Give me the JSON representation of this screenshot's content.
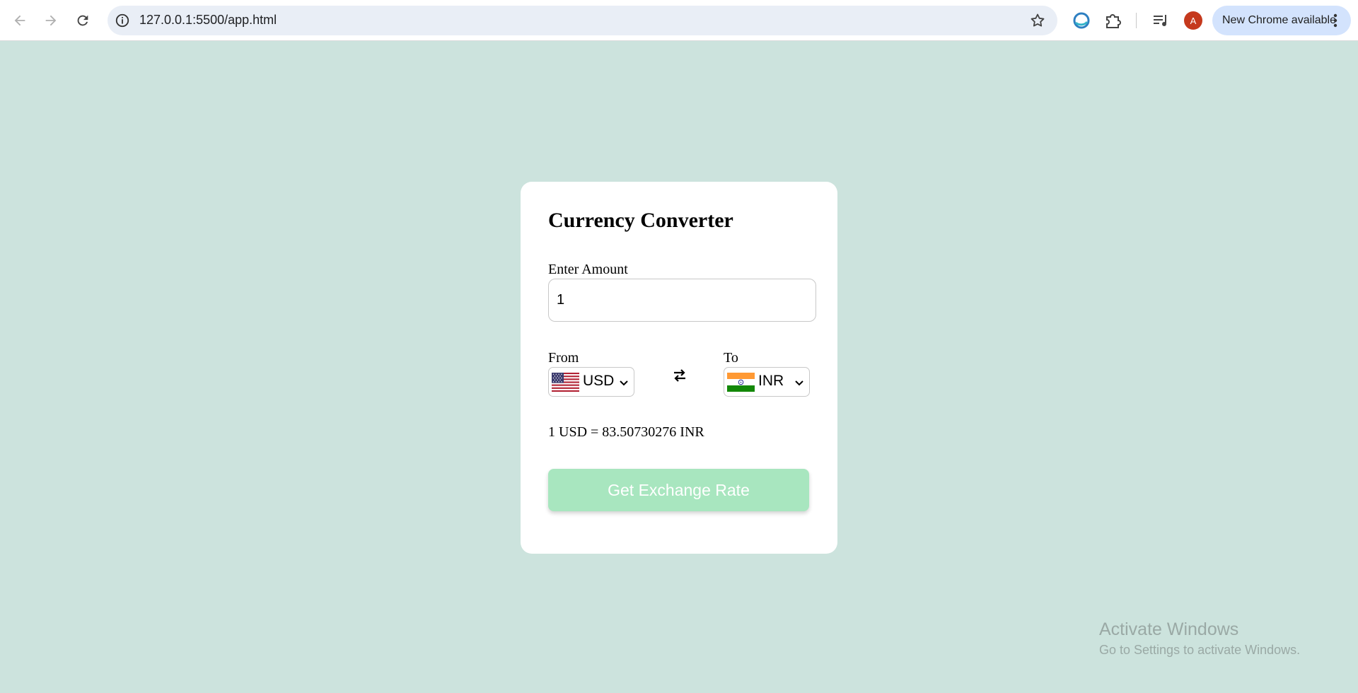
{
  "browser": {
    "url": "127.0.0.1:5500/app.html",
    "profile_initial": "A",
    "update_label": "New Chrome available",
    "icons": [
      "back-arrow-icon",
      "forward-arrow-icon",
      "reload-icon",
      "site-info-icon",
      "bookmark-star-icon",
      "edge-extension-icon",
      "puzzle-extension-icon",
      "media-playlist-icon",
      "kebab-menu-icon"
    ]
  },
  "converter": {
    "title": "Currency Converter",
    "amount_label": "Enter Amount",
    "amount_value": "1",
    "from_label": "From",
    "from_currency": "USD",
    "to_label": "To",
    "to_currency": "INR",
    "rate_message": "1 USD = 83.50730276 INR",
    "button_label": "Get Exchange Rate",
    "colors": {
      "page_bg": "#cce3dd",
      "card_bg": "#ffffff",
      "button_bg": "#a8e6bf"
    }
  },
  "watermark": {
    "title": "Activate Windows",
    "subtitle": "Go to Settings to activate Windows."
  }
}
